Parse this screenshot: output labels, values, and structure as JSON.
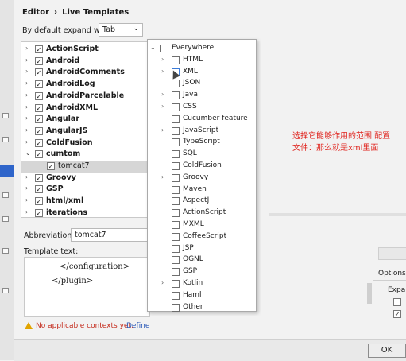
{
  "header": {
    "breadcrumb_root": "Editor",
    "breadcrumb_sep": "›",
    "breadcrumb_page": "Live Templates"
  },
  "expand": {
    "label": "By default expand with",
    "value": "Tab",
    "chevron": "⌄"
  },
  "template_groups": [
    {
      "label": "ActionScript",
      "expanded": false,
      "checked": true
    },
    {
      "label": "Android",
      "expanded": false,
      "checked": true
    },
    {
      "label": "AndroidComments",
      "expanded": false,
      "checked": true
    },
    {
      "label": "AndroidLog",
      "expanded": false,
      "checked": true
    },
    {
      "label": "AndroidParcelable",
      "expanded": false,
      "checked": true
    },
    {
      "label": "AndroidXML",
      "expanded": false,
      "checked": true
    },
    {
      "label": "Angular",
      "expanded": false,
      "checked": true
    },
    {
      "label": "AngularJS",
      "expanded": false,
      "checked": true
    },
    {
      "label": "ColdFusion",
      "expanded": false,
      "checked": true
    },
    {
      "label": "cumtom",
      "expanded": true,
      "checked": true
    },
    {
      "label": "tomcat7",
      "child": true,
      "checked": true,
      "selected": true
    },
    {
      "label": "Groovy",
      "expanded": false,
      "checked": true
    },
    {
      "label": "GSP",
      "expanded": false,
      "checked": true
    },
    {
      "label": "html/xml",
      "expanded": false,
      "checked": true
    },
    {
      "label": "iterations",
      "expanded": false,
      "checked": true
    }
  ],
  "contexts": [
    {
      "label": "Everywhere",
      "level": 0,
      "arrow": "⌄"
    },
    {
      "label": "HTML",
      "level": 1,
      "arrow": "›"
    },
    {
      "label": "XML",
      "level": 1,
      "arrow": "›",
      "highlight": true
    },
    {
      "label": "JSON",
      "level": 1,
      "arrow": ""
    },
    {
      "label": "Java",
      "level": 1,
      "arrow": "›"
    },
    {
      "label": "CSS",
      "level": 1,
      "arrow": "›"
    },
    {
      "label": "Cucumber feature",
      "level": 1,
      "arrow": ""
    },
    {
      "label": "JavaScript",
      "level": 1,
      "arrow": "›"
    },
    {
      "label": "TypeScript",
      "level": 1,
      "arrow": ""
    },
    {
      "label": "SQL",
      "level": 1,
      "arrow": ""
    },
    {
      "label": "ColdFusion",
      "level": 1,
      "arrow": ""
    },
    {
      "label": "Groovy",
      "level": 1,
      "arrow": "›"
    },
    {
      "label": "Maven",
      "level": 1,
      "arrow": ""
    },
    {
      "label": "AspectJ",
      "level": 1,
      "arrow": ""
    },
    {
      "label": "ActionScript",
      "level": 1,
      "arrow": ""
    },
    {
      "label": "MXML",
      "level": 1,
      "arrow": ""
    },
    {
      "label": "CoffeeScript",
      "level": 1,
      "arrow": ""
    },
    {
      "label": "JSP",
      "level": 1,
      "arrow": ""
    },
    {
      "label": "OGNL",
      "level": 1,
      "arrow": ""
    },
    {
      "label": "GSP",
      "level": 1,
      "arrow": ""
    },
    {
      "label": "Kotlin",
      "level": 1,
      "arrow": "›"
    },
    {
      "label": "Haml",
      "level": 1,
      "arrow": ""
    },
    {
      "label": "Other",
      "level": 1,
      "arrow": ""
    }
  ],
  "abbreviation": {
    "label": "Abbreviation:",
    "value": "tomcat7"
  },
  "template_text": {
    "label": "Template text:",
    "lines": [
      "</configuration>",
      "</plugin>"
    ]
  },
  "warning": {
    "text": "No applicable contexts yet.",
    "link": "Define"
  },
  "annotation": {
    "text": "选择它能够作用的范围 配置文件：那么就是xml里面",
    "color": "#e0241e"
  },
  "options": {
    "label": "Options",
    "expand_label": "Expan"
  },
  "buttons": {
    "ok": "OK"
  },
  "colors": {
    "accent": "#2f65ca",
    "warning_text": "#c42b1c",
    "link": "#2a59b8"
  }
}
